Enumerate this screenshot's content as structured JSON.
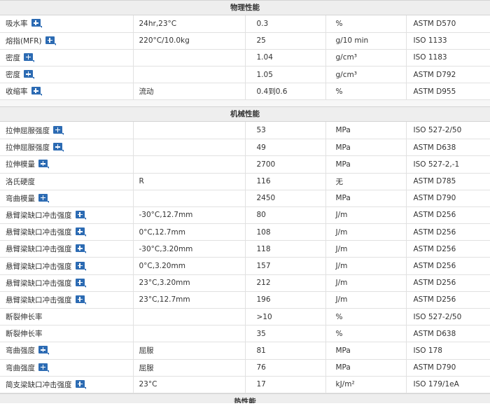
{
  "sections": [
    {
      "title": "物理性能",
      "rows": [
        {
          "property": "吸水率",
          "has_icon": true,
          "condition": "24hr,23°C",
          "value": "0.3",
          "unit": "%",
          "standard": "ASTM D570"
        },
        {
          "property": "熔指(MFR)",
          "has_icon": true,
          "condition": "220°C/10.0kg",
          "value": "25",
          "unit": "g/10 min",
          "standard": "ISO 1133"
        },
        {
          "property": "密度",
          "has_icon": true,
          "condition": "",
          "value": "1.04",
          "unit": "g/cm³",
          "standard": "ISO 1183"
        },
        {
          "property": "密度",
          "has_icon": true,
          "condition": "",
          "value": "1.05",
          "unit": "g/cm³",
          "standard": "ASTM D792"
        },
        {
          "property": "收缩率",
          "has_icon": true,
          "condition": "流动",
          "value": "0.4到0.6",
          "unit": "%",
          "standard": "ASTM D955"
        }
      ]
    },
    {
      "title": "机械性能",
      "rows": [
        {
          "property": "拉伸屈服强度",
          "has_icon": true,
          "condition": "",
          "value": "53",
          "unit": "MPa",
          "standard": "ISO 527-2/50"
        },
        {
          "property": "拉伸屈服强度",
          "has_icon": true,
          "condition": "",
          "value": "49",
          "unit": "MPa",
          "standard": "ASTM D638"
        },
        {
          "property": "拉伸模量",
          "has_icon": true,
          "condition": "",
          "value": "2700",
          "unit": "MPa",
          "standard": "ISO 527-2,-1"
        },
        {
          "property": "洛氏硬度",
          "has_icon": false,
          "condition": "R",
          "value": "116",
          "unit": "无",
          "standard": "ASTM D785"
        },
        {
          "property": "弯曲模量",
          "has_icon": true,
          "condition": "",
          "value": "2450",
          "unit": "MPa",
          "standard": "ASTM D790"
        },
        {
          "property": "悬臂梁缺口冲击强度",
          "has_icon": true,
          "condition": "-30°C,12.7mm",
          "value": "80",
          "unit": "J/m",
          "standard": "ASTM D256"
        },
        {
          "property": "悬臂梁缺口冲击强度",
          "has_icon": true,
          "condition": "0°C,12.7mm",
          "value": "108",
          "unit": "J/m",
          "standard": "ASTM D256"
        },
        {
          "property": "悬臂梁缺口冲击强度",
          "has_icon": true,
          "condition": "-30°C,3.20mm",
          "value": "118",
          "unit": "J/m",
          "standard": "ASTM D256"
        },
        {
          "property": "悬臂梁缺口冲击强度",
          "has_icon": true,
          "condition": "0°C,3.20mm",
          "value": "157",
          "unit": "J/m",
          "standard": "ASTM D256"
        },
        {
          "property": "悬臂梁缺口冲击强度",
          "has_icon": true,
          "condition": "23°C,3.20mm",
          "value": "212",
          "unit": "J/m",
          "standard": "ASTM D256"
        },
        {
          "property": "悬臂梁缺口冲击强度",
          "has_icon": true,
          "condition": "23°C,12.7mm",
          "value": "196",
          "unit": "J/m",
          "standard": "ASTM D256"
        },
        {
          "property": "断裂伸长率",
          "has_icon": false,
          "condition": "",
          "value": ">10",
          "unit": "%",
          "standard": "ISO 527-2/50"
        },
        {
          "property": "断裂伸长率",
          "has_icon": false,
          "condition": "",
          "value": "35",
          "unit": "%",
          "standard": "ASTM D638"
        },
        {
          "property": "弯曲强度",
          "has_icon": true,
          "condition": "屈服",
          "value": "81",
          "unit": "MPa",
          "standard": "ISO 178"
        },
        {
          "property": "弯曲强度",
          "has_icon": true,
          "condition": "屈服",
          "value": "76",
          "unit": "MPa",
          "standard": "ASTM D790"
        },
        {
          "property": "简支梁缺口冲击强度",
          "has_icon": true,
          "condition": "23°C",
          "value": "17",
          "unit": "kJ/m²",
          "standard": "ISO 179/1eA"
        }
      ]
    }
  ],
  "next_section_title": "热性能",
  "icon_name": "plus-info-icon",
  "colors": {
    "icon": "#2c6bb3",
    "header_bg": "#eeeeee",
    "border": "#e1e1e1"
  }
}
